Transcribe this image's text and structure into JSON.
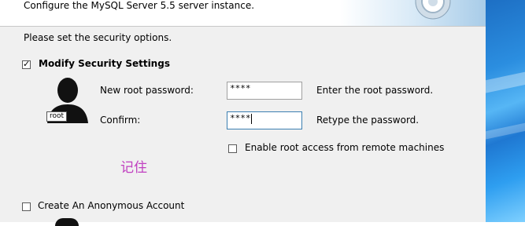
{
  "header": {
    "subtitle": "Configure the MySQL Server 5.5 server instance."
  },
  "security": {
    "prompt": "Please set the security options.",
    "modify_label": "Modify Security Settings",
    "modify_checked": true,
    "new_pw_label": "New root password:",
    "new_pw_value": "****",
    "new_pw_hint": "Enter the root password.",
    "confirm_label": "Confirm:",
    "confirm_value": "****",
    "confirm_hint": "Retype the password.",
    "remote_label": "Enable root access from remote machines",
    "remote_checked": false,
    "avatar_badge": "root"
  },
  "annotation": "记住",
  "anonymous": {
    "label": "Create An Anonymous Account",
    "checked": false
  }
}
